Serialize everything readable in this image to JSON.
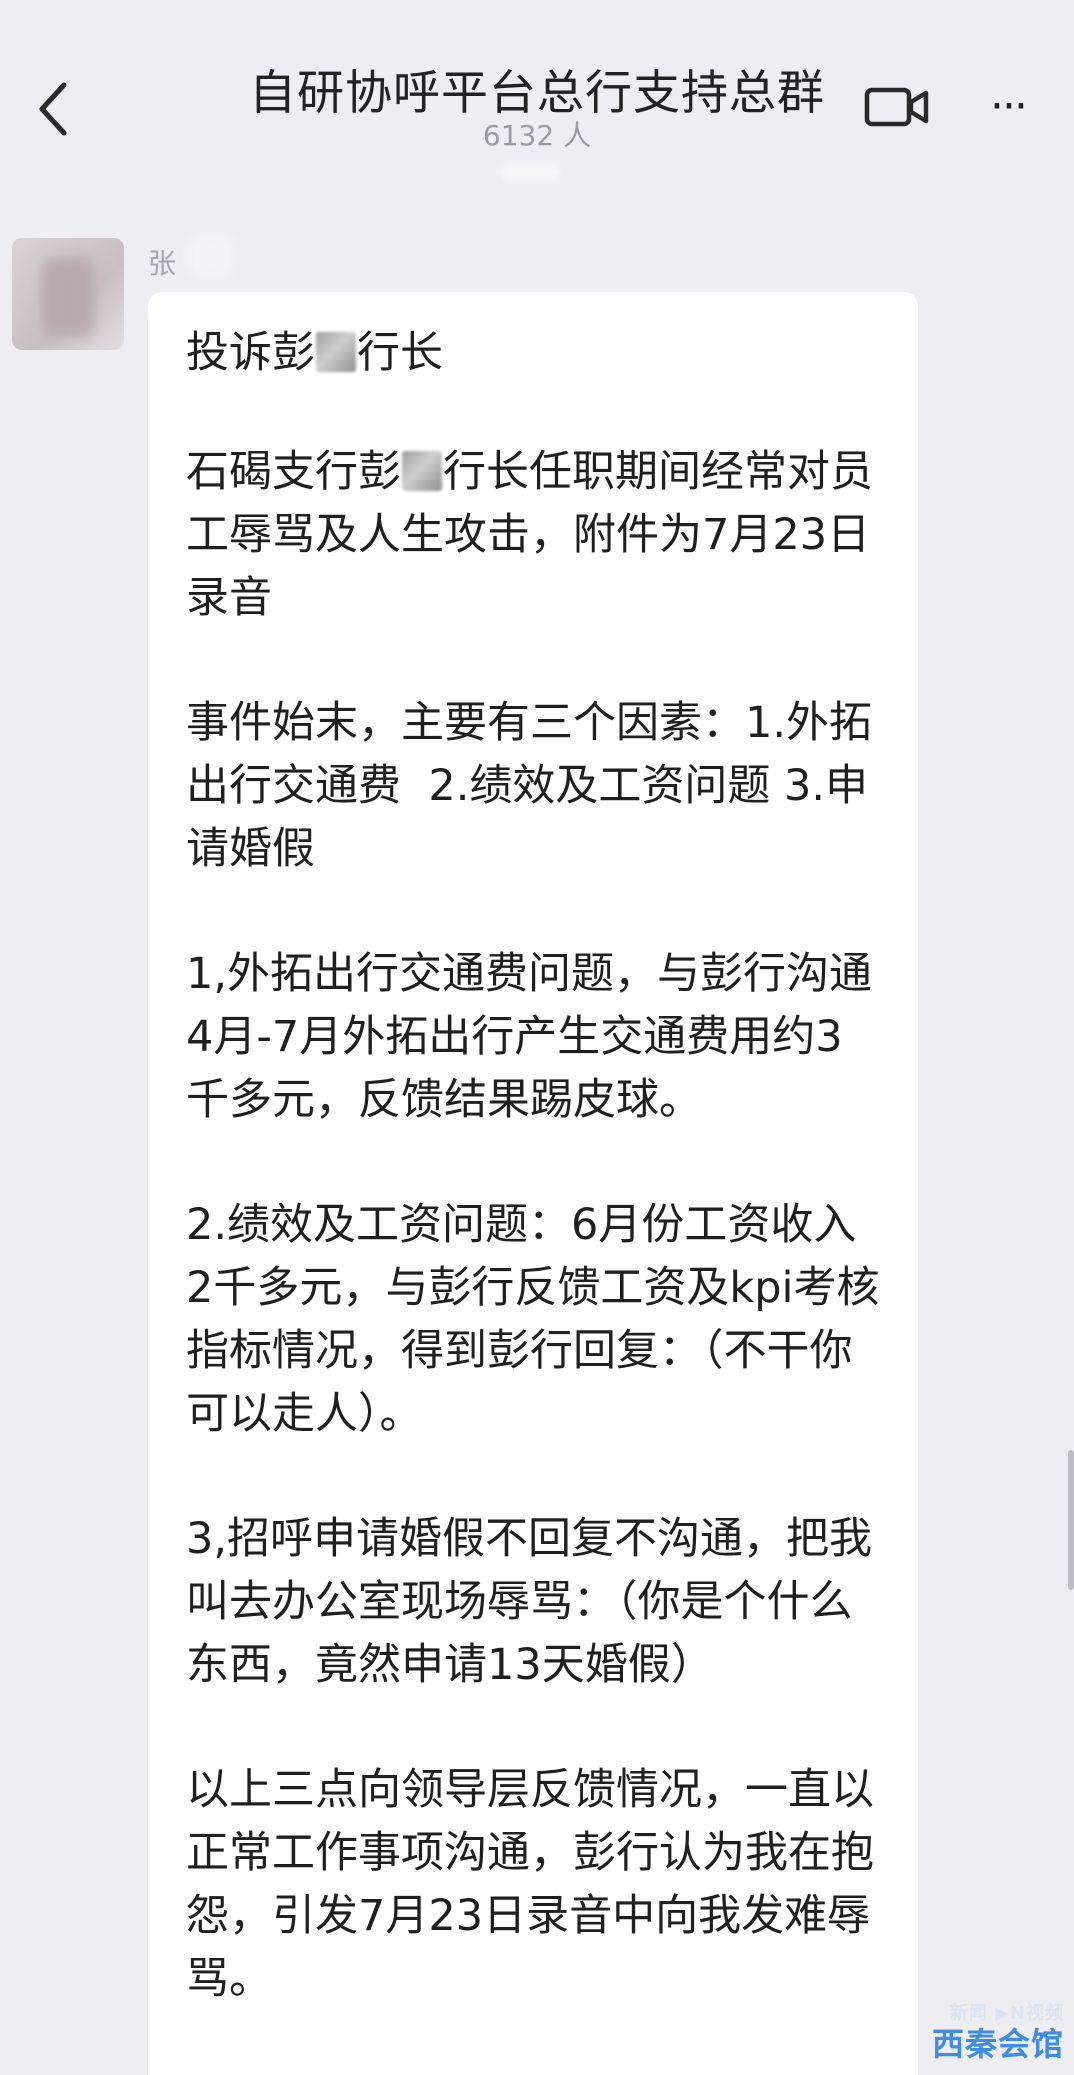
{
  "header": {
    "back_icon": "chevron-left-icon",
    "title": "自研协呼平台总行支持总群",
    "member_count": "6132 人",
    "video_icon": "video-camera-icon",
    "more_icon": "more-dots-icon",
    "more_glyph": "···"
  },
  "message": {
    "sender": "张",
    "paragraphs": [
      {
        "pre": "投诉彭",
        "post": "行长"
      },
      {
        "pre": "石碣支行彭",
        "post": "行长任职期间经常对员工辱骂及人生攻击，附件为7月23日录音"
      },
      {
        "pre": "事件始末，主要有三个因素：1.外拓出行交通费  2.绩效及工资问题 3.申请婚假"
      },
      {
        "pre": "1,外拓出行交通费问题，与彭行沟通4月-7月外拓出行产生交通费用约3千多元，反馈结果踢皮球。"
      },
      {
        "pre": "2.绩效及工资问题：6月份工资收入2千多元，与彭行反馈工资及kpi考核指标情况，得到彭行回复：（不干你可以走人）。"
      },
      {
        "pre": "3,招呼申请婚假不回复不沟通，把我叫去办公室现场辱骂：（你是个什么东西，竟然申请13天婚假）"
      },
      {
        "pre": "以上三点向领导层反馈情况，一直以正常工作事项沟通，彭行认为我在抱怨，引发7月23日录音中向我发难辱骂。"
      }
    ]
  },
  "watermark": {
    "top": "新闻 ▶N视频",
    "bottom": "西秦会馆"
  },
  "colors": {
    "background": "#ededf2",
    "bubble": "#ffffff",
    "watermark_accent": "#3f8de0"
  }
}
